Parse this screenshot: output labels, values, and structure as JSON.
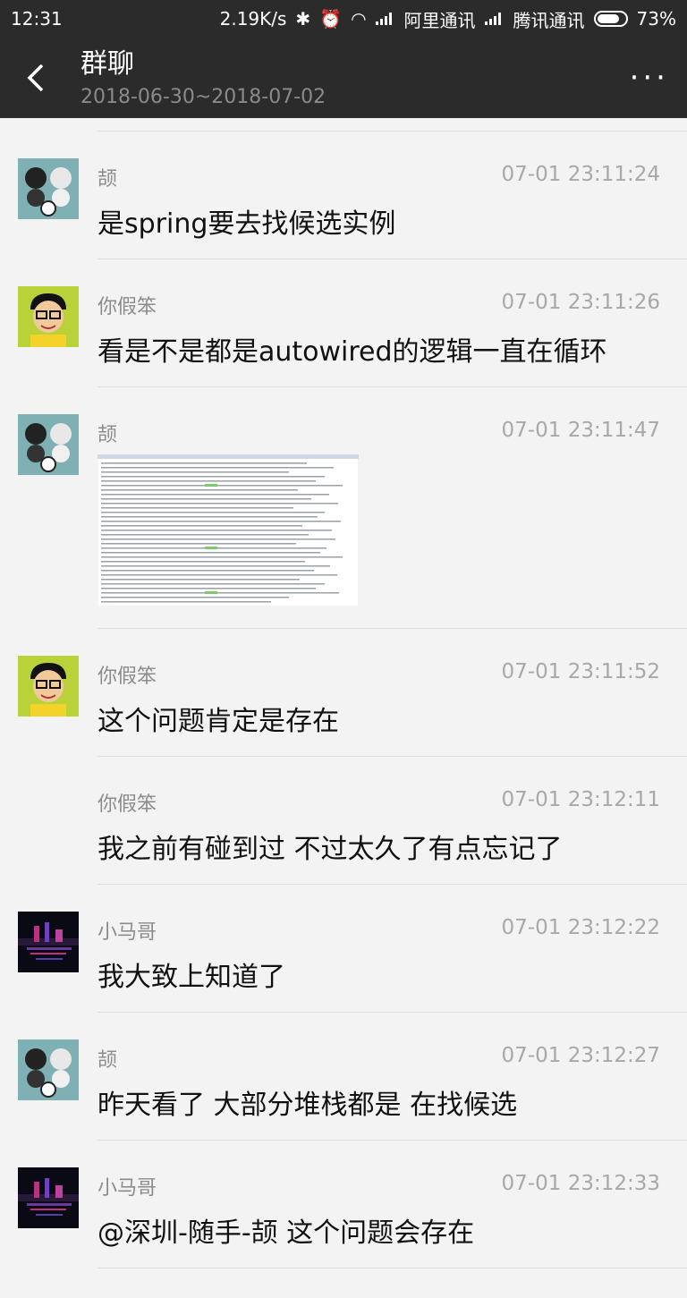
{
  "statusbar": {
    "time": "12:31",
    "speed": "2.19K/s",
    "carrier1": "阿里通讯",
    "carrier2": "腾讯通讯",
    "battery": "73%"
  },
  "header": {
    "title": "群聊",
    "date_range": "2018-06-30~2018-07-02",
    "more_icon": "···"
  },
  "messages": [
    {
      "name": "颉",
      "time": "07-01 23:11:24",
      "text": "是spring要去找候选实例",
      "avatar": "panda"
    },
    {
      "name": "你假笨",
      "time": "07-01 23:11:26",
      "text": "看是不是都是autowired的逻辑一直在循环",
      "avatar": "cartoon-boy"
    },
    {
      "name": "颉",
      "time": "07-01 23:11:47",
      "text": "",
      "avatar": "panda",
      "image": "stacktrace-screenshot"
    },
    {
      "name": "你假笨",
      "time": "07-01 23:11:52",
      "text": "这个问题肯定是存在",
      "avatar": "cartoon-boy"
    },
    {
      "name": "你假笨",
      "time": "07-01 23:12:11",
      "text": "我之前有碰到过 不过太久了有点忘记了",
      "avatar": ""
    },
    {
      "name": "小马哥",
      "time": "07-01 23:12:22",
      "text": "我大致上知道了",
      "avatar": "night-city"
    },
    {
      "name": "颉",
      "time": "07-01 23:12:27",
      "text": "昨天看了 大部分堆栈都是 在找候选",
      "avatar": "panda"
    },
    {
      "name": "小马哥",
      "time": "07-01 23:12:33",
      "text": "@深圳-随手-颉 这个问题会存在",
      "avatar": "night-city"
    }
  ]
}
